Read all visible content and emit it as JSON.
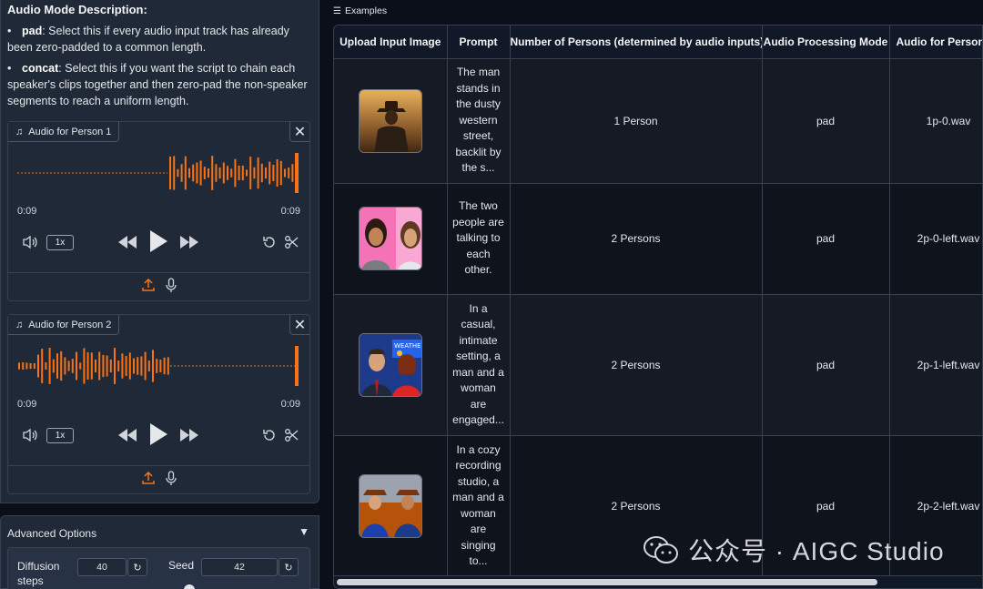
{
  "description": {
    "title": "Audio Mode Description:",
    "items": [
      {
        "term": "pad",
        "text": ": Select this if every audio input track has already been zero-padded to a common length."
      },
      {
        "term": "concat",
        "text": ": Select this if you want the script to chain each speaker's clips together and then zero-pad the non-speaker segments to reach a uniform length."
      }
    ]
  },
  "audio_players": [
    {
      "label": "Audio for Person 1",
      "time_start": "0:09",
      "time_end": "0:09",
      "speed": "1x"
    },
    {
      "label": "Audio for Person 2",
      "time_start": "0:09",
      "time_end": "0:09",
      "speed": "1x"
    }
  ],
  "advanced": {
    "title": "Advanced Options",
    "diffusion_label": "Diffusion steps",
    "diffusion_value": "40",
    "seed_label": "Seed",
    "seed_value": "42"
  },
  "examples": {
    "label": "Examples",
    "headers": [
      "Upload Input Image",
      "Prompt",
      "Number of Persons (determined by audio inputs)",
      "Audio Processing Mode",
      "Audio for Person"
    ],
    "rows": [
      {
        "prompt": "The man stands in the dusty western street, backlit by the s...",
        "persons": "1 Person",
        "mode": "pad",
        "audio": "1p-0.wav"
      },
      {
        "prompt": "The two people are talking to each other.",
        "persons": "2 Persons",
        "mode": "pad",
        "audio": "2p-0-left.wav"
      },
      {
        "prompt": "In a casual, intimate setting, a man and a woman are engaged...",
        "persons": "2 Persons",
        "mode": "pad",
        "audio": "2p-1-left.wav"
      },
      {
        "prompt": "In a cozy recording studio, a man and a woman are singing to...",
        "persons": "2 Persons",
        "mode": "pad",
        "audio": "2p-2-left.wav"
      }
    ]
  },
  "watermark": {
    "text": "公众号 · AIGC Studio"
  },
  "colors": {
    "accent": "#f97316",
    "panel": "#1f2937",
    "background": "#0b0f19"
  }
}
